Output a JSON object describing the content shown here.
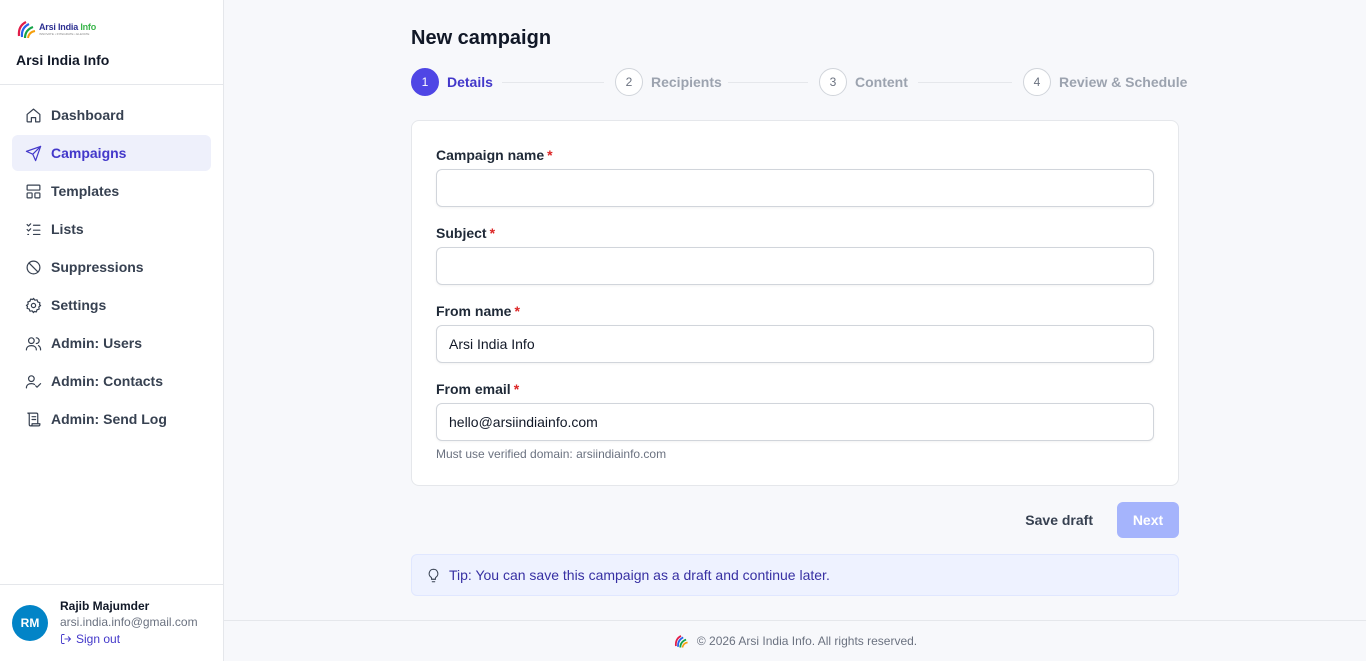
{
  "brand": {
    "logo_text_primary": "Arsi India",
    "logo_text_secondary": "Info",
    "logo_tagline": "INNOVATE • INTEGRATE • ELEVATE",
    "name": "Arsi India Info"
  },
  "sidebar": {
    "items": [
      {
        "label": "Dashboard",
        "icon": "home-icon"
      },
      {
        "label": "Campaigns",
        "icon": "send-icon"
      },
      {
        "label": "Templates",
        "icon": "layout-icon"
      },
      {
        "label": "Lists",
        "icon": "list-check-icon"
      },
      {
        "label": "Suppressions",
        "icon": "ban-icon"
      },
      {
        "label": "Settings",
        "icon": "gear-icon"
      },
      {
        "label": "Admin: Users",
        "icon": "users-icon"
      },
      {
        "label": "Admin: Contacts",
        "icon": "user-check-icon"
      },
      {
        "label": "Admin: Send Log",
        "icon": "scroll-icon"
      }
    ],
    "active_index": 1
  },
  "user": {
    "initials": "RM",
    "name": "Rajib Majumder",
    "email": "arsi.india.info@gmail.com",
    "signout_label": "Sign out"
  },
  "page": {
    "title": "New campaign"
  },
  "stepper": {
    "steps": [
      {
        "num": "1",
        "label": "Details",
        "active": true
      },
      {
        "num": "2",
        "label": "Recipients",
        "active": false
      },
      {
        "num": "3",
        "label": "Content",
        "active": false
      },
      {
        "num": "4",
        "label": "Review & Schedule",
        "active": false
      }
    ]
  },
  "form": {
    "campaign_name": {
      "label": "Campaign name",
      "required": "*",
      "value": ""
    },
    "subject": {
      "label": "Subject",
      "required": "*",
      "value": ""
    },
    "from_name": {
      "label": "From name",
      "required": "*",
      "value": "Arsi India Info"
    },
    "from_email": {
      "label": "From email",
      "required": "*",
      "value": "hello@arsiindiainfo.com",
      "hint": "Must use verified domain: arsiindiainfo.com"
    }
  },
  "actions": {
    "save_draft_label": "Save draft",
    "next_label": "Next"
  },
  "tip": {
    "text": "Tip: You can save this campaign as a draft and continue later."
  },
  "footer": {
    "text": "© 2026 Arsi India Info. All rights reserved."
  },
  "colors": {
    "accent": "#4f46e5",
    "accent_text": "#4338ca",
    "next_disabled": "#a5b4fc",
    "avatar": "#0284c7",
    "required": "#dc2626"
  }
}
